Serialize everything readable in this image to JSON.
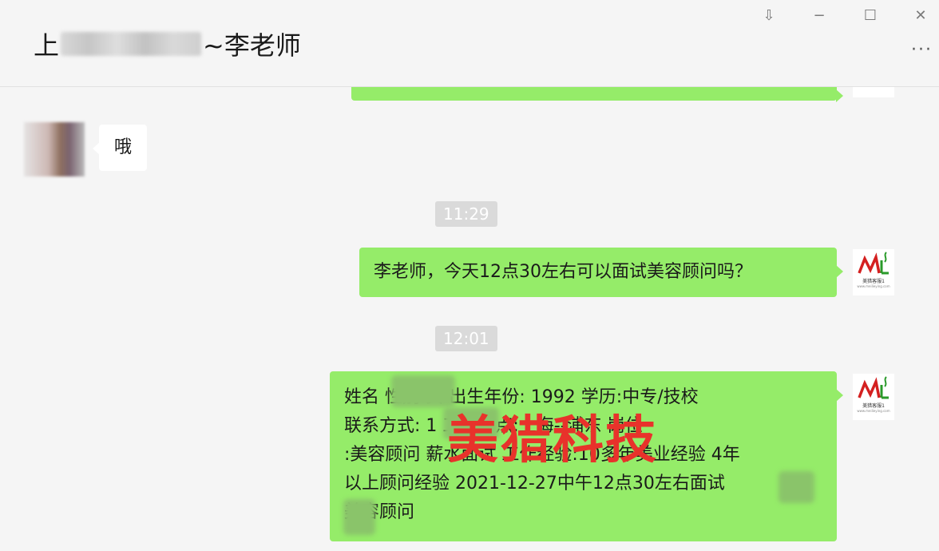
{
  "window": {
    "title_prefix": "上",
    "title_suffix": "~李老师",
    "pin": "⇩",
    "minimize": "−",
    "maximize": "☐",
    "close": "✕",
    "more": "···"
  },
  "messages": {
    "received_1": "哦",
    "time_1": "11:29",
    "sent_1": "李老师，今天12点30左右可以面试美容顾问吗？",
    "time_2": "12:01",
    "sent_2_lines": [
      "姓名          性别:女 出生年份: 1992 学历:中专/技校",
      " 联系方式: 1            工作地点:上海--浦东 岗位",
      ":美容顾问 薪水面试    工作经验:10多年美业经验 4年",
      "以上顾问经验 2021-12-27中午12点30左右面试",
      "     美容顾问"
    ]
  },
  "avatar_logo": {
    "brand": "美猎客服1",
    "site": "www.meilieying.com"
  },
  "watermark": "美猎科技",
  "colors": {
    "sent_bubble": "#95ec69",
    "received_bubble": "#ffffff",
    "background": "#f5f5f5",
    "watermark": "#e8322b"
  }
}
